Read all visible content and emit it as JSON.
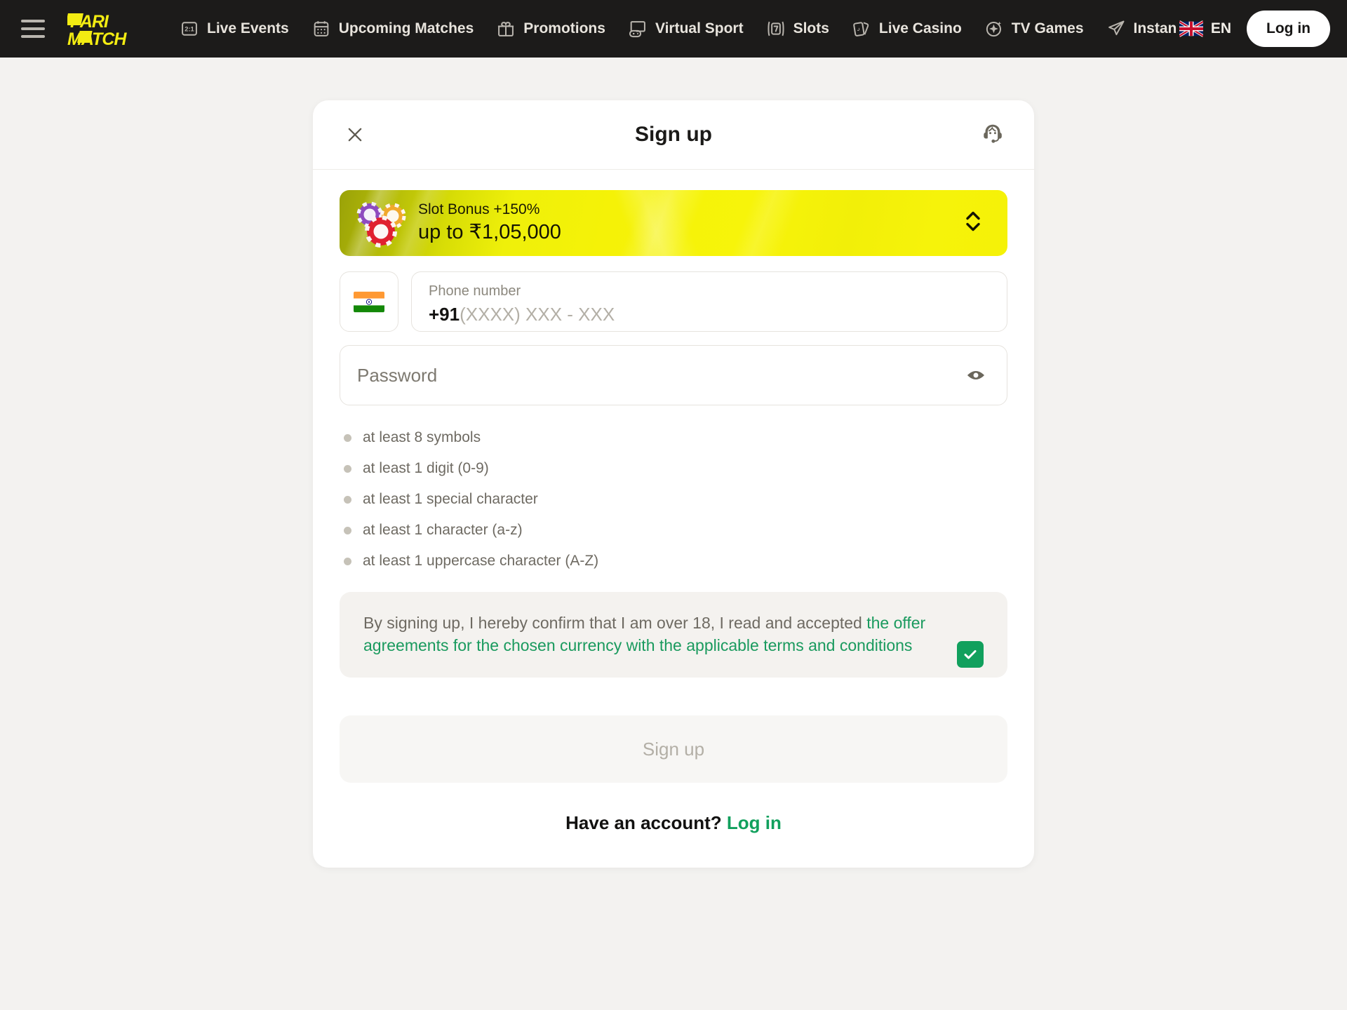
{
  "topbar": {
    "menu_icon": "hamburger-menu-icon",
    "brand": {
      "line1": "PARI",
      "line2": "MATCH"
    },
    "nav_items": [
      {
        "label": "Live Events",
        "icon": "live-score-icon"
      },
      {
        "label": "Upcoming Matches",
        "icon": "calendar-icon"
      },
      {
        "label": "Promotions",
        "icon": "gift-icon"
      },
      {
        "label": "Virtual Sport",
        "icon": "gamepad-icon"
      },
      {
        "label": "Slots",
        "icon": "slot-seven-icon"
      },
      {
        "label": "Live Casino",
        "icon": "playing-cards-icon"
      },
      {
        "label": "TV Games",
        "icon": "sparkle-icon"
      },
      {
        "label": "Instant",
        "icon": "rocket-icon"
      }
    ],
    "language": {
      "code": "EN",
      "flag": "uk-flag-icon"
    },
    "login_label": "Log in"
  },
  "modal": {
    "title": "Sign up",
    "close_icon": "close-icon",
    "support_icon": "support-headset-icon",
    "bonus": {
      "icon": "casino-chips-icon",
      "line1": "Slot Bonus +150%",
      "line2": "up to ₹1,05,000",
      "selector_icon": "chevron-up-down-icon"
    },
    "phone": {
      "country_flag": "india-flag-icon",
      "label": "Phone number",
      "dial_code": "+91",
      "mask": "(XXXX) XXX - XXX"
    },
    "password": {
      "placeholder": "Password",
      "value": "",
      "toggle_icon": "eye-icon"
    },
    "requirements": [
      "at least 8 symbols",
      "at least 1 digit (0-9)",
      "at least 1 special character",
      "at least 1 character (a-z)",
      "at least 1 uppercase character (A-Z)"
    ],
    "terms": {
      "plain_text": "By signing up, I hereby confirm that I am over 18, I read and accepted ",
      "link_text": "the offer agreements for the chosen currency with the applicable terms and conditions",
      "checked": true,
      "check_icon": "checkmark-icon"
    },
    "submit_label": "Sign up",
    "footer": {
      "question": "Have an account?",
      "link": "Log in"
    }
  },
  "colors": {
    "brand_yellow": "#f3ec12",
    "topbar_bg": "#1c1b1a",
    "page_bg": "#f3f2f0",
    "accent_green": "#11a05d",
    "bonus_yellow": "#f5f207",
    "muted_text": "#6e6a62"
  }
}
